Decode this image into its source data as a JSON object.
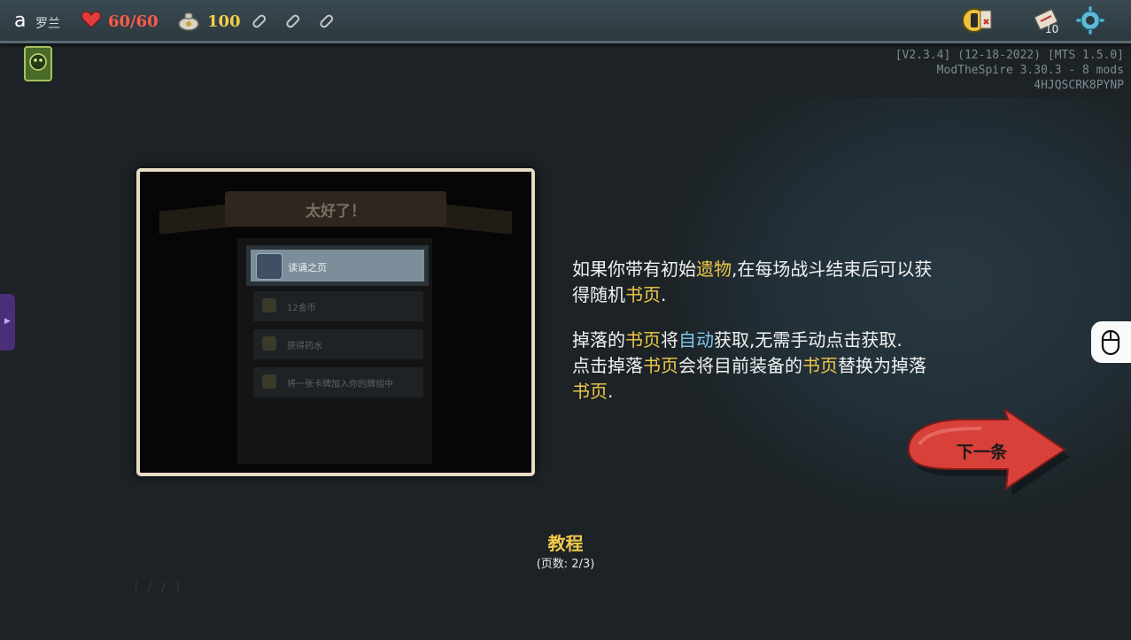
{
  "topbar": {
    "player_letter": "a",
    "player_name": "罗兰",
    "hp": "60/60",
    "gold": "100",
    "deck_count": "10",
    "heart_color": "#e23b3b",
    "gold_color": "#f2cf4a"
  },
  "version": {
    "line1": "[V2.3.4] (12-18-2022) [MTS 1.5.0]",
    "line2": "ModTheSpire 3.30.3 - 8 mods",
    "line3": "4HJQSCRK8PYNP"
  },
  "preview": {
    "banner": "太好了！",
    "options": [
      "读诵之页",
      "12金币",
      "获得药水",
      "将一张卡牌加入你的牌组中"
    ]
  },
  "tutorial": {
    "para1": {
      "t1": "如果你带有初始",
      "h1": "遗物",
      "t2": ",在每场战斗结束后可以获",
      "t3": "得随机",
      "h2": "书页",
      "t4": "."
    },
    "para2": {
      "t1": "掉落的",
      "h1": "书页",
      "t2": "将",
      "h2": "自动",
      "t3": "获取,无需手动点击获取."
    },
    "para3": {
      "t1": "点击掉落",
      "h1": "书页",
      "t2": "会将目前装备的",
      "h2": "书页",
      "t3": "替换为掉落",
      "h3": "书页",
      "t4": "."
    },
    "next_label": "下一条",
    "title": "教程",
    "page": "(页数: 2/3)"
  },
  "ghost_text": "[ / / ]",
  "icons": {
    "heart": "heart-icon",
    "gold": "gold-pouch-icon",
    "potion": "potion-slot-icon",
    "map": "map-icon",
    "deck": "deck-icon",
    "settings": "gear-icon",
    "relic": "relic-icon",
    "mouse": "mouse-icon",
    "next": "red-arrow-icon"
  }
}
